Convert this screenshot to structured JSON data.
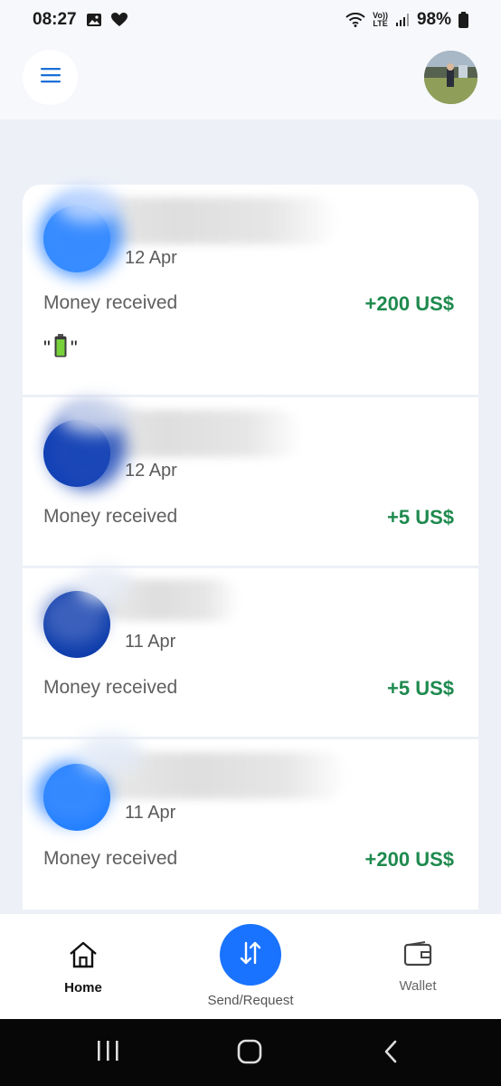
{
  "status_bar": {
    "time": "08:27",
    "battery": "98%",
    "network_top": "Vo))",
    "network_bottom": "LTE",
    "icons": [
      "gallery-icon",
      "heart-icon",
      "wifi-icon",
      "signal-icon",
      "battery-icon"
    ]
  },
  "header": {
    "menu_icon": "hamburger-icon",
    "avatar": "profile-avatar"
  },
  "transactions": [
    {
      "date": "12 Apr",
      "label": "Money received",
      "amount": "+200 US$",
      "note_open": "\"",
      "note_close": "\"",
      "note_icon": "battery-emoji-icon"
    },
    {
      "date": "12 Apr",
      "label": "Money received",
      "amount": "+5 US$"
    },
    {
      "date": "11 Apr",
      "label": "Money received",
      "amount": "+5 US$"
    },
    {
      "date": "11 Apr",
      "label": "Money received",
      "amount": "+200 US$"
    }
  ],
  "bottom_nav": {
    "home": "Home",
    "send": "Send/Request",
    "wallet": "Wallet"
  },
  "colors": {
    "accent": "#1a73ff",
    "amount_green": "#1e8a4e",
    "background": "#edf0f7"
  }
}
